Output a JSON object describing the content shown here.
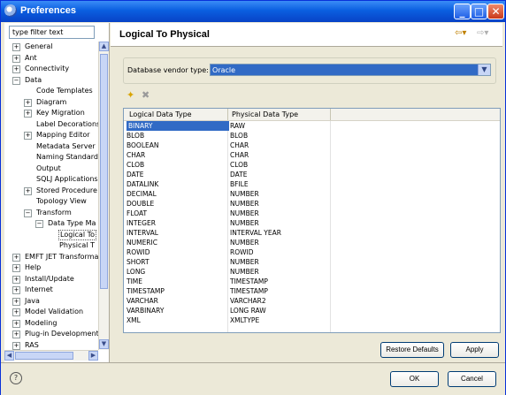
{
  "window": {
    "title": "Preferences"
  },
  "filter": {
    "placeholder": "type filter text"
  },
  "tree": [
    {
      "label": "General",
      "indent": 0,
      "toggle": "+"
    },
    {
      "label": "Ant",
      "indent": 0,
      "toggle": "+"
    },
    {
      "label": "Connectivity",
      "indent": 0,
      "toggle": "+"
    },
    {
      "label": "Data",
      "indent": 0,
      "toggle": "-"
    },
    {
      "label": "Code Templates",
      "indent": 1,
      "toggle": ""
    },
    {
      "label": "Diagram",
      "indent": 1,
      "toggle": "+"
    },
    {
      "label": "Key Migration",
      "indent": 1,
      "toggle": "+"
    },
    {
      "label": "Label Decorations",
      "indent": 1,
      "toggle": ""
    },
    {
      "label": "Mapping Editor",
      "indent": 1,
      "toggle": "+"
    },
    {
      "label": "Metadata Server",
      "indent": 1,
      "toggle": ""
    },
    {
      "label": "Naming Standard",
      "indent": 1,
      "toggle": ""
    },
    {
      "label": "Output",
      "indent": 1,
      "toggle": ""
    },
    {
      "label": "SQLJ Applications",
      "indent": 1,
      "toggle": ""
    },
    {
      "label": "Stored Procedure",
      "indent": 1,
      "toggle": "+"
    },
    {
      "label": "Topology View",
      "indent": 1,
      "toggle": ""
    },
    {
      "label": "Transform",
      "indent": 1,
      "toggle": "-"
    },
    {
      "label": "Data Type Ma",
      "indent": 2,
      "toggle": "-"
    },
    {
      "label": "Logical To",
      "indent": 3,
      "toggle": "",
      "selected": true
    },
    {
      "label": "Physical T",
      "indent": 3,
      "toggle": ""
    },
    {
      "label": "EMFT JET Transforma",
      "indent": 0,
      "toggle": "+"
    },
    {
      "label": "Help",
      "indent": 0,
      "toggle": "+"
    },
    {
      "label": "Install/Update",
      "indent": 0,
      "toggle": "+"
    },
    {
      "label": "Internet",
      "indent": 0,
      "toggle": "+"
    },
    {
      "label": "Java",
      "indent": 0,
      "toggle": "+"
    },
    {
      "label": "Model Validation",
      "indent": 0,
      "toggle": "+"
    },
    {
      "label": "Modeling",
      "indent": 0,
      "toggle": "+"
    },
    {
      "label": "Plug-in Development",
      "indent": 0,
      "toggle": "+"
    },
    {
      "label": "RAS",
      "indent": 0,
      "toggle": "+"
    }
  ],
  "page": {
    "title": "Logical To Physical",
    "vendor_label": "Database vendor type:",
    "vendor_value": "Oracle",
    "columns": [
      "Logical Data Type",
      "Physical Data Type"
    ],
    "rows": [
      [
        "BINARY",
        "RAW"
      ],
      [
        "BLOB",
        "BLOB"
      ],
      [
        "BOOLEAN",
        "CHAR"
      ],
      [
        "CHAR",
        "CHAR"
      ],
      [
        "CLOB",
        "CLOB"
      ],
      [
        "DATE",
        "DATE"
      ],
      [
        "DATALINK",
        "BFILE"
      ],
      [
        "DECIMAL",
        "NUMBER"
      ],
      [
        "DOUBLE",
        "NUMBER"
      ],
      [
        "FLOAT",
        "NUMBER"
      ],
      [
        "INTEGER",
        "NUMBER"
      ],
      [
        "INTERVAL",
        "INTERVAL YEAR"
      ],
      [
        "NUMERIC",
        "NUMBER"
      ],
      [
        "ROWID",
        "ROWID"
      ],
      [
        "SHORT",
        "NUMBER"
      ],
      [
        "LONG",
        "NUMBER"
      ],
      [
        "TIME",
        "TIMESTAMP"
      ],
      [
        "TIMESTAMP",
        "TIMESTAMP"
      ],
      [
        "VARCHAR",
        "VARCHAR2"
      ],
      [
        "VARBINARY",
        "LONG RAW"
      ],
      [
        "XML",
        "XMLTYPE"
      ]
    ],
    "restore_label": "Restore Defaults",
    "apply_label": "Apply"
  },
  "footer": {
    "ok_label": "OK",
    "cancel_label": "Cancel",
    "help_glyph": "?"
  },
  "colors": {
    "selection": "#316ac5",
    "titlebar": "#0a5fe0"
  }
}
